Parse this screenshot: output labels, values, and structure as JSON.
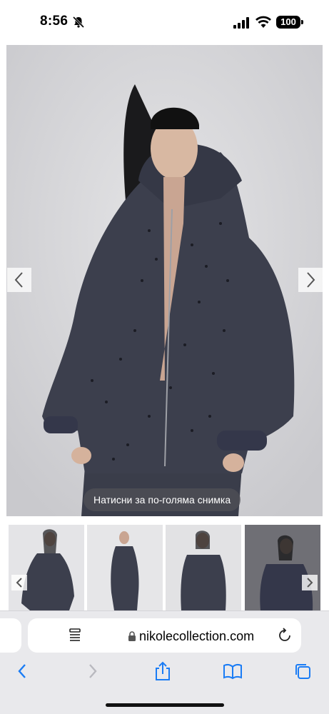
{
  "status_bar": {
    "time": "8:56",
    "battery": "100"
  },
  "main_image": {
    "alt": "Model wearing dark grey oversized zip hoodie with rhinestones",
    "zoom_hint": "Натисни за по-голяма снимка"
  },
  "thumbnails": [
    {
      "name": "thumbnail-1"
    },
    {
      "name": "thumbnail-2"
    },
    {
      "name": "thumbnail-3"
    },
    {
      "name": "thumbnail-4"
    }
  ],
  "browser": {
    "url": "nikolecollection.com"
  },
  "colors": {
    "garment": "#3c3f4d",
    "background": "#d9d9dc",
    "accent": "#1a7cf5"
  }
}
